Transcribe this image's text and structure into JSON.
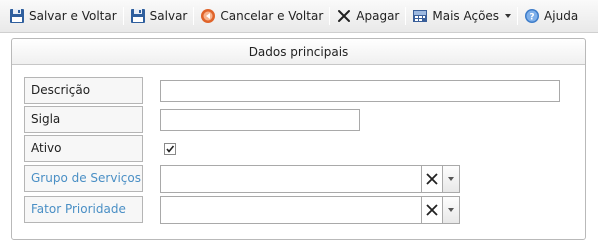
{
  "toolbar": {
    "items": [
      {
        "label": "Salvar e Voltar",
        "icon": "floppy-disk-icon"
      },
      {
        "label": "Salvar",
        "icon": "floppy-disk-icon"
      },
      {
        "label": "Cancelar e Voltar",
        "icon": "cancel-back-icon"
      },
      {
        "label": "Apagar",
        "icon": "x-delete-icon"
      },
      {
        "label": "Mais Ações",
        "icon": "more-actions-icon"
      },
      {
        "label": "Ajuda",
        "icon": "help-icon"
      }
    ]
  },
  "panel": {
    "title": "Dados principais",
    "fields": {
      "descricao": {
        "label": "Descrição",
        "value": ""
      },
      "sigla": {
        "label": "Sigla",
        "value": ""
      },
      "ativo": {
        "label": "Ativo",
        "checked": true
      },
      "grupo_servicos": {
        "label": "Grupo de Serviços",
        "value": ""
      },
      "fator_prioridade": {
        "label": "Fator Prioridade",
        "value": ""
      }
    }
  },
  "colors": {
    "link_label": "#4a8fc5",
    "label_bg": "#f7f7f7",
    "border": "#b5b5b5",
    "floppy_blue": "#2f5f9e",
    "cancel_orange": "#e0642a",
    "help_blue": "#3d7cc9"
  }
}
